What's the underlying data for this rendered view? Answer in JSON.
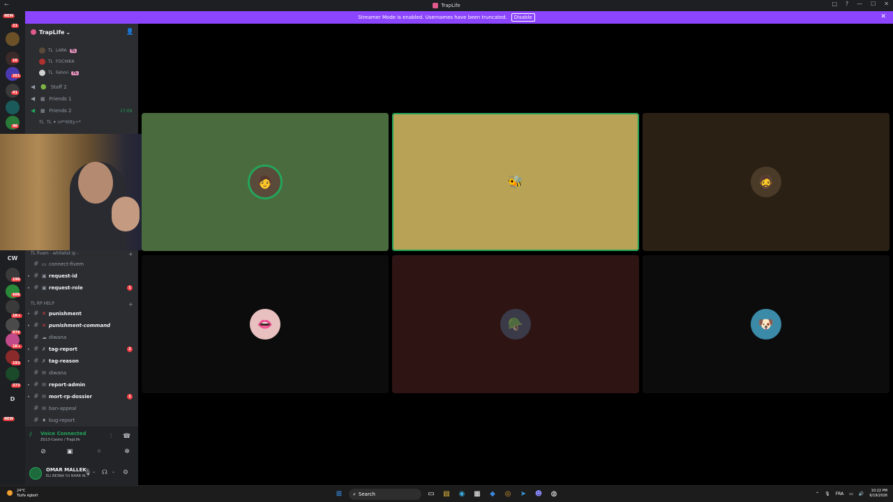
{
  "window": {
    "title": "TrapLife",
    "back": "←",
    "controls": [
      "□",
      "?",
      "—",
      "☐",
      "✕"
    ]
  },
  "banner": {
    "text": "Streamer Mode is enabled. Usernames have been truncated.",
    "button": "Disable",
    "close": "✕"
  },
  "rail": {
    "pill_top": "NEW",
    "badge_1": "21",
    "badge_2": "16",
    "badge_3": "261",
    "badge_4": "41",
    "badge_5": "96",
    "cw": "CW",
    "badge_6": "196",
    "badge_7": "606",
    "badge_8": "1K+",
    "badge_9": "976",
    "badge_10": "1K+",
    "badge_11": "193",
    "badge_12": "373",
    "d": "D",
    "pill_bottom": "NEW"
  },
  "server": {
    "name": "TrapLife",
    "chevron": "⌄",
    "add_user": "👤"
  },
  "voice_users": [
    {
      "tag": "TL",
      "name": "LARA",
      "badge": "TL"
    },
    {
      "tag": "TL",
      "name": "FOCHIKA",
      "badge": ""
    },
    {
      "tag": "TL",
      "name": "Fehmi",
      "badge": "TL"
    }
  ],
  "voice_channels": [
    {
      "emoji": "🟢",
      "name": "Staff 2",
      "time": ""
    },
    {
      "emoji": "▦",
      "name": "Friends 1",
      "time": ""
    },
    {
      "emoji": "▦",
      "name": "Friends 2",
      "time": "17:09"
    }
  ],
  "voice_user_last": {
    "tag": "TL",
    "name": "TL ✦ ni*ᵏKitty✧*"
  },
  "categories": {
    "fivem": "TL fivem - whitelist ip -",
    "rp_help": "TL RP HELP"
  },
  "channels_fivem": [
    {
      "name": "connect-fivem",
      "bold": false,
      "unread": ""
    },
    {
      "name": "request-id",
      "bold": true,
      "unread": ""
    },
    {
      "name": "request-role",
      "bold": true,
      "unread": "1"
    }
  ],
  "channels_help": [
    {
      "name": "punishment",
      "bold": true,
      "unread": ""
    },
    {
      "name": "punishment-command",
      "bold": true,
      "unread": ""
    },
    {
      "name": "diwana",
      "bold": false,
      "unread": ""
    },
    {
      "name": "tag-report",
      "bold": true,
      "unread": "2"
    },
    {
      "name": "tag-reason",
      "bold": true,
      "unread": ""
    },
    {
      "name": "diwana",
      "bold": false,
      "unread": ""
    },
    {
      "name": "report-admin",
      "bold": true,
      "unread": ""
    },
    {
      "name": "mort-rp-dossier",
      "bold": true,
      "unread": "1"
    },
    {
      "name": "ban-appeal",
      "bold": false,
      "unread": ""
    },
    {
      "name": "bug-report",
      "bold": false,
      "unread": ""
    }
  ],
  "voice_panel": {
    "status": "Voice Connected",
    "location": "ZG13-Casino / TrapLife"
  },
  "user_panel": {
    "name": "OMAR MALLEK",
    "status": "ELI BE3NA Y.II NHAR W..."
  },
  "tiles": [
    {
      "color": "#4a6b3e",
      "avatar": "🧑",
      "speaking": false
    },
    {
      "color": "#b8a255",
      "avatar": "🐝",
      "speaking": true
    },
    {
      "color": "#2a2014",
      "avatar": "🧔",
      "speaking": false
    },
    {
      "color": "#0c0c0c",
      "avatar": "👄",
      "speaking": false
    },
    {
      "color": "#2f1414",
      "avatar": "🪖",
      "speaking": false
    },
    {
      "color": "#0c0c0c",
      "avatar": "🐶",
      "speaking": false
    }
  ],
  "taskbar": {
    "weather_temp": "24°C",
    "weather_desc": "Tüzfa égbolt",
    "search": "Search",
    "lang": "FRA",
    "time": "10:22 PM",
    "date": "6/19/2026"
  }
}
